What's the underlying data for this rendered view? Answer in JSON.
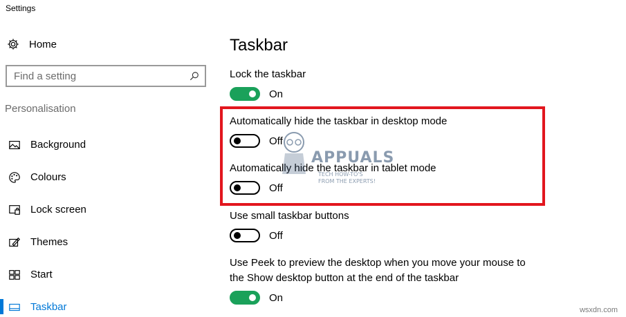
{
  "window": {
    "title": "Settings"
  },
  "sidebar": {
    "home_label": "Home",
    "search": {
      "placeholder": "Find a setting",
      "value": ""
    },
    "section_label": "Personalisation",
    "items": [
      {
        "label": "Background",
        "icon": "image-icon"
      },
      {
        "label": "Colours",
        "icon": "palette-icon"
      },
      {
        "label": "Lock screen",
        "icon": "lock-screen-icon"
      },
      {
        "label": "Themes",
        "icon": "themes-icon"
      },
      {
        "label": "Start",
        "icon": "start-icon"
      },
      {
        "label": "Taskbar",
        "icon": "taskbar-icon",
        "active": true
      }
    ]
  },
  "main": {
    "title": "Taskbar",
    "settings": [
      {
        "label": "Lock the taskbar",
        "state": "On"
      },
      {
        "label": "Automatically hide the taskbar in desktop mode",
        "state": "Off"
      },
      {
        "label": "Automatically hide the taskbar in tablet mode",
        "state": "Off"
      },
      {
        "label": "Use small taskbar buttons",
        "state": "Off"
      },
      {
        "label": "Use Peek to preview the desktop when you move your mouse to",
        "label_line2": "the Show desktop button at the end of the taskbar",
        "state": "On"
      }
    ]
  },
  "watermark": {
    "name": "APPUALS",
    "tagline": "TECH HOW-TO'S FROM THE EXPERTS!"
  },
  "site_mark": "wsxdn.com",
  "colors": {
    "accent": "#0078d7",
    "toggle_on": "#1aa15a",
    "highlight": "#e2161e",
    "secondary_text": "#6b6b6b"
  }
}
